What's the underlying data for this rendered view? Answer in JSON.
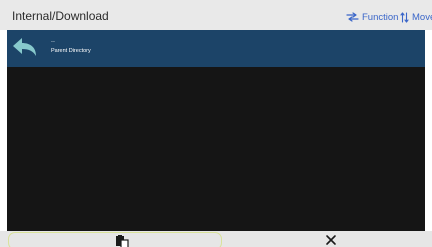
{
  "header": {
    "path": "Internal/Download",
    "function_label": "Function",
    "move_label": "Move"
  },
  "list": {
    "items": [
      {
        "top_text": "..",
        "label": "Parent Directory",
        "icon": "back-arrow-icon"
      }
    ]
  },
  "bottom_bar": {
    "paste_icon": "paste-icon",
    "close_icon": "close-icon"
  },
  "colors": {
    "header_bg": "#e9e9e9",
    "accent": "#3a66c9",
    "content_bg": "#151515",
    "row_bg": "#1c4468",
    "back_arrow": "#87c9cc",
    "highlight_border": "#d9e29a"
  }
}
